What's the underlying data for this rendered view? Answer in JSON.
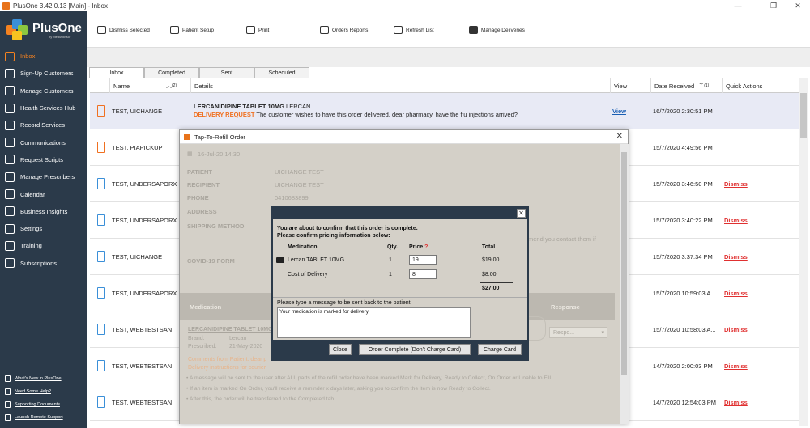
{
  "window": {
    "title": "PlusOne 3.42.0.13 [Main] - Inbox",
    "minimize": "—",
    "maximize": "❐",
    "close": "✕"
  },
  "logo": {
    "name": "PlusOne",
    "sub": "by MediAdvisor"
  },
  "sidebar": {
    "items": [
      {
        "label": "Inbox",
        "icon": "inbox-icon"
      },
      {
        "label": "Sign-Up Customers",
        "icon": "user-add-icon"
      },
      {
        "label": "Manage Customers",
        "icon": "users-icon"
      },
      {
        "label": "Health Services Hub",
        "icon": "health-icon"
      },
      {
        "label": "Record Services",
        "icon": "record-icon"
      },
      {
        "label": "Communications",
        "icon": "communications-icon"
      },
      {
        "label": "Request Scripts",
        "icon": "script-icon"
      },
      {
        "label": "Manage Prescribers",
        "icon": "prescriber-icon"
      },
      {
        "label": "Calendar",
        "icon": "calendar-icon"
      },
      {
        "label": "Business Insights",
        "icon": "insights-icon"
      },
      {
        "label": "Settings",
        "icon": "settings-icon"
      },
      {
        "label": "Training",
        "icon": "help-icon"
      },
      {
        "label": "Subscriptions",
        "icon": "subscriptions-icon"
      }
    ],
    "bottom_links": [
      "What's New in PlusOne",
      "Need Some Help?",
      "Supporting Documents",
      "Launch Remote Support"
    ]
  },
  "toolbar": [
    "Dismiss Selected",
    "Patient Setup",
    "Print",
    "Orders Reports",
    "Refresh List",
    "Manage Deliveries"
  ],
  "tabs": [
    "Inbox",
    "Completed",
    "Sent",
    "Scheduled"
  ],
  "table": {
    "headers": {
      "name": "Name",
      "name_sort": "(2)",
      "details": "Details",
      "view": "View",
      "received": "Date Received",
      "received_sort": "(1)",
      "actions": "Quick Actions"
    },
    "rows": [
      {
        "name": "TEST, UICHANGE",
        "detail_title": "LERCANIDIPINE TABLET 10MG",
        "detail_title_suffix": " LERCAN",
        "detail_tag": "DELIVERY REQUEST",
        "detail_text": " The customer wishes to have this order delivered. dear pharmacy, have the flu injections arrived?",
        "view": "View",
        "received": "16/7/2020 2:30:51 PM",
        "action": ""
      },
      {
        "name": "TEST, PIAPICKUP",
        "received": "15/7/2020 4:49:56 PM",
        "action": ""
      },
      {
        "name": "TEST, UNDERSAPORX",
        "received": "15/7/2020 3:46:50 PM",
        "action": "Dismiss"
      },
      {
        "name": "TEST, UNDERSAPORX",
        "received": "15/7/2020 3:40:22 PM",
        "action": "Dismiss"
      },
      {
        "name": "TEST, UICHANGE",
        "received": "15/7/2020 3:37:34 PM",
        "action": "Dismiss"
      },
      {
        "name": "TEST, UNDERSAPORX",
        "received": "15/7/2020 10:59:03 A...",
        "action": "Dismiss"
      },
      {
        "name": "TEST, WEBTESTSAN",
        "received": "15/7/2020 10:58:03 A...",
        "action": "Dismiss"
      },
      {
        "name": "TEST, WEBTESTSAN",
        "received": "14/7/2020 2:00:03 PM",
        "action": "Dismiss"
      },
      {
        "name": "TEST, WEBTESTSAN",
        "received": "14/7/2020 12:54:03 PM",
        "action": "Dismiss"
      }
    ]
  },
  "refill_dialog": {
    "title": "Tap-To-Refill Order",
    "date": "16-Jul-20 14:30",
    "fields": [
      {
        "label": "PATIENT",
        "value": "UICHANGE TEST"
      },
      {
        "label": "RECIPIENT",
        "value": "UICHANGE TEST"
      },
      {
        "label": "PHONE",
        "value": "0410683899"
      },
      {
        "label": "ADDRESS",
        "value": ""
      },
      {
        "label": "SHIPPING METHOD",
        "value": ""
      }
    ],
    "covid_label": "COVID-19 FORM",
    "recommend_text": "mend you contact them if",
    "med_header": "Medication",
    "response_header": "Response",
    "med_name": "LERCANIDIPINE TABLET 10MG",
    "brand_label": "Brand:",
    "brand_value": "Lercan",
    "prescribed_label": "Prescribed:",
    "prescribed_value": "21-May-2020",
    "comments": "Comments from Patient: dear p",
    "delivery_instr": "Delivery instructions for courier",
    "response_placeholder": "Respo...",
    "notes": [
      "• A message will be sent to the user after ALL parts of the refill order have been marked Mark for Delivery, Ready to Collect, On Order or Unable to Fill.",
      "• If an item is marked On Order, you'll receive a reminder x days later, asking you to confirm the item is now Ready to Collect.",
      "• After this, the order will be transferred to the Completed tab."
    ]
  },
  "confirm_dialog": {
    "message1": "You are about to confirm that this order is complete.",
    "message2": "Please confirm pricing information below:",
    "headers": {
      "medication": "Medication",
      "qty": "Qty.",
      "price": "Price",
      "price_help": "?",
      "total": "Total"
    },
    "rows": [
      {
        "name": "Lercan TABLET 10MG",
        "qty": "1",
        "price": "19",
        "total": "$19.00"
      },
      {
        "name": "Cost of Delivery",
        "qty": "1",
        "price": "8",
        "total": "$8.00"
      }
    ],
    "grand_total": "$27.00",
    "message_label": "Please type a message to be sent back to the patient:",
    "message_value": "Your medication is marked for delivery.",
    "buttons": {
      "close": "Close",
      "no_charge": "Order Complete (Don't Charge Card)",
      "charge": "Charge Card"
    }
  }
}
